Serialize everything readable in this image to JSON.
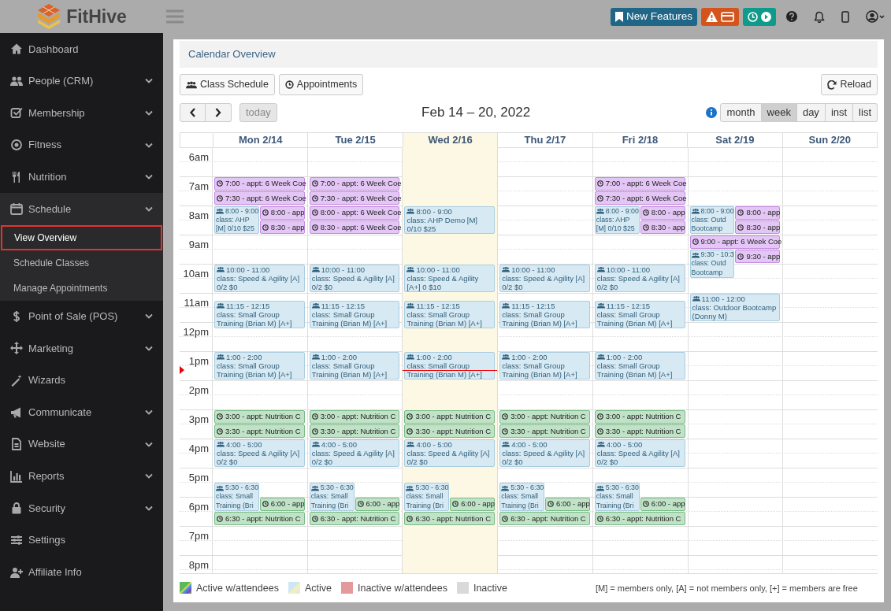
{
  "brand": "FitHive",
  "topbar": {
    "new_features": "New Features"
  },
  "sidebar": {
    "items": [
      {
        "label": "Dashboard"
      },
      {
        "label": "People (CRM)",
        "expanded": false
      },
      {
        "label": "Membership",
        "expanded": false
      },
      {
        "label": "Fitness",
        "expanded": false
      },
      {
        "label": "Nutrition",
        "expanded": false
      },
      {
        "label": "Schedule",
        "expanded": true,
        "children": [
          {
            "label": "View Overview",
            "selected": true
          },
          {
            "label": "Schedule Classes",
            "selected": false
          },
          {
            "label": "Manage Appointments",
            "selected": false
          }
        ]
      },
      {
        "label": "Point of Sale (POS)",
        "expanded": false
      },
      {
        "label": "Marketing",
        "expanded": false
      },
      {
        "label": "Wizards"
      },
      {
        "label": "Communicate",
        "expanded": false
      },
      {
        "label": "Website",
        "expanded": false
      },
      {
        "label": "Reports",
        "expanded": false
      },
      {
        "label": "Security",
        "expanded": false
      },
      {
        "label": "Settings"
      },
      {
        "label": "Affiliate Info"
      }
    ]
  },
  "page": {
    "title": "Calendar Overview",
    "buttons": [
      {
        "label": "Class Schedule",
        "kind": "classes"
      },
      {
        "label": "Appointments",
        "kind": "appointments"
      }
    ],
    "reload": "Reload"
  },
  "calendar": {
    "title": "Feb 14 – 20, 2022",
    "today_button": {
      "label": "today",
      "disabled": true
    },
    "views": [
      {
        "label": "month",
        "selected": false
      },
      {
        "label": "week",
        "selected": true
      },
      {
        "label": "day",
        "selected": false
      },
      {
        "label": "inst",
        "selected": false
      },
      {
        "label": "list",
        "selected": false
      }
    ],
    "hours": [
      "6am",
      "7am",
      "8am",
      "9am",
      "10am",
      "11am",
      "12pm",
      "1pm",
      "2pm",
      "3pm",
      "4pm",
      "5pm",
      "6pm",
      "7pm",
      "8pm"
    ],
    "now": {
      "level": 0.51
    },
    "days": [
      {
        "label": "Mon 2/14",
        "today": false,
        "events": [
          {
            "kind": "appt",
            "text": "7:00 - appt: 6 Week Coe",
            "narrow": false,
            "overlay": false,
            "color": "#e3c6f5"
          },
          {
            "kind": "appt",
            "text": "7:30 - appt: 6 Week Coe",
            "narrow": false,
            "overlay": false,
            "color": "#e3c6f5"
          },
          {
            "kind": "class",
            "time": "8:00 - 9:00",
            "lines": [
              "class: AHP",
              "[M] 0/10 $25"
            ],
            "narrow": true,
            "overlay": false,
            "color": "#d7e9f3"
          },
          {
            "kind": "appt",
            "text": "8:00 - app",
            "narrow": false,
            "overlay": true,
            "color": "#e3c6f5"
          },
          {
            "kind": "appt",
            "text": "8:30 - app",
            "narrow": false,
            "overlay": true,
            "color": "#e3c6f5"
          },
          {
            "kind": "class",
            "time": "10:00 - 11:00",
            "title": "class: Speed & Agility [A] 0/2 $0",
            "narrow": false,
            "overlay": false,
            "color": "#d7e9f3"
          },
          {
            "kind": "class",
            "time": "11:15 - 12:15",
            "title": "class: Small Group Training (Brian M) [A+]",
            "narrow": false,
            "overlay": false,
            "color": "#d7e9f3"
          },
          {
            "kind": "class",
            "time": "1:00 - 2:00",
            "title": "class: Small Group Training (Brian M) [A+]",
            "narrow": false,
            "overlay": false,
            "color": "#d7e9f3"
          },
          {
            "kind": "appt",
            "text": "3:00 - appt: Nutrition C",
            "narrow": false,
            "overlay": false,
            "color": "#c0e2c7"
          },
          {
            "kind": "appt",
            "text": "3:30 - appt: Nutrition C",
            "narrow": false,
            "overlay": false,
            "color": "#c0e2c7"
          },
          {
            "kind": "class",
            "time": "4:00 - 5:00",
            "title": "class: Speed & Agility [A] 0/2 $0",
            "narrow": false,
            "overlay": false,
            "color": "#d7e9f3"
          },
          {
            "kind": "class",
            "time": "5:30 - 6:30",
            "lines": [
              "class: Small",
              "Training (Bri"
            ],
            "narrow": true,
            "overlay": false,
            "color": "#d7e9f3"
          },
          {
            "kind": "appt",
            "text": "6:00 - app",
            "narrow": false,
            "overlay": true,
            "color": "#c0e2c7"
          },
          {
            "kind": "appt",
            "text": "6:30 - appt: Nutrition C",
            "narrow": false,
            "overlay": false,
            "color": "#c0e2c7"
          }
        ]
      },
      {
        "label": "Tue 2/15",
        "today": false,
        "events": [
          {
            "kind": "appt",
            "text": "7:00 - appt: 6 Week Coe",
            "narrow": false,
            "overlay": false,
            "color": "#e3c6f5"
          },
          {
            "kind": "appt",
            "text": "7:30 - appt: 6 Week Coe",
            "narrow": false,
            "overlay": false,
            "color": "#e3c6f5"
          },
          {
            "kind": "appt",
            "text": "8:00 - appt: 6 Week Coe",
            "narrow": false,
            "overlay": false,
            "color": "#e3c6f5"
          },
          {
            "kind": "appt",
            "text": "8:30 - appt: 6 Week Coe",
            "narrow": false,
            "overlay": false,
            "color": "#e3c6f5"
          },
          {
            "kind": "class",
            "time": "10:00 - 11:00",
            "title": "class: Speed & Agility [A] 0/2 $0",
            "narrow": false,
            "overlay": false,
            "color": "#d7e9f3"
          },
          {
            "kind": "class",
            "time": "11:15 - 12:15",
            "title": "class: Small Group Training (Brian M) [A+]",
            "narrow": false,
            "overlay": false,
            "color": "#d7e9f3"
          },
          {
            "kind": "class",
            "time": "1:00 - 2:00",
            "title": "class: Small Group Training (Brian M) [A+]",
            "narrow": false,
            "overlay": false,
            "color": "#d7e9f3"
          },
          {
            "kind": "appt",
            "text": "3:00 - appt: Nutrition C",
            "narrow": false,
            "overlay": false,
            "color": "#c0e2c7"
          },
          {
            "kind": "appt",
            "text": "3:30 - appt: Nutrition C",
            "narrow": false,
            "overlay": false,
            "color": "#c0e2c7"
          },
          {
            "kind": "class",
            "time": "4:00 - 5:00",
            "title": "class: Speed & Agility [A] 0/2 $0",
            "narrow": false,
            "overlay": false,
            "color": "#d7e9f3"
          },
          {
            "kind": "class",
            "time": "5:30 - 6:30",
            "lines": [
              "class: Small",
              "Training (Bri"
            ],
            "narrow": true,
            "overlay": false,
            "color": "#d7e9f3"
          },
          {
            "kind": "appt",
            "text": "6:00 - app",
            "narrow": false,
            "overlay": true,
            "color": "#c0e2c7"
          },
          {
            "kind": "appt",
            "text": "6:30 - appt: Nutrition C",
            "narrow": false,
            "overlay": false,
            "color": "#c0e2c7"
          }
        ]
      },
      {
        "label": "Wed 2/16",
        "today": true,
        "events": [
          {
            "kind": "class",
            "time": "8:00 - 9:00",
            "title": "class: AHP Demo [M] 0/10 $25",
            "narrow": false,
            "overlay": false,
            "color": "#d7e9f3"
          },
          {
            "kind": "class",
            "time": "10:00 - 11:00",
            "title": "class: Speed & Agility [A+] 0 $10",
            "narrow": false,
            "overlay": false,
            "color": "#d7e9f3"
          },
          {
            "kind": "class",
            "time": "11:15 - 12:15",
            "title": "class: Small Group Training (Brian M) [A+]",
            "narrow": false,
            "overlay": false,
            "color": "#d7e9f3"
          },
          {
            "kind": "class",
            "time": "1:00 - 2:00",
            "title": "class: Small Group Training (Brian M) [A+]",
            "narrow": false,
            "overlay": false,
            "color": "#d7e9f3"
          },
          {
            "kind": "appt",
            "text": "3:00 - appt: Nutrition C",
            "narrow": false,
            "overlay": false,
            "color": "#c0e2c7"
          },
          {
            "kind": "appt",
            "text": "3:30 - appt: Nutrition C",
            "narrow": false,
            "overlay": false,
            "color": "#c0e2c7"
          },
          {
            "kind": "class",
            "time": "4:00 - 5:00",
            "title": "class: Speed & Agility [A] 0/2 $0",
            "narrow": false,
            "overlay": false,
            "color": "#d7e9f3"
          },
          {
            "kind": "class",
            "time": "5:30 - 6:30",
            "lines": [
              "class: Small",
              "Training (Bri"
            ],
            "narrow": true,
            "overlay": false,
            "color": "#d7e9f3"
          },
          {
            "kind": "appt",
            "text": "6:00 - app",
            "narrow": false,
            "overlay": true,
            "color": "#c0e2c7"
          },
          {
            "kind": "appt",
            "text": "6:30 - appt: Nutrition C",
            "narrow": false,
            "overlay": false,
            "color": "#c0e2c7"
          }
        ]
      },
      {
        "label": "Thu 2/17",
        "today": false,
        "events": [
          {
            "kind": "class",
            "time": "10:00 - 11:00",
            "title": "class: Speed & Agility [A] 0/2 $0",
            "narrow": false,
            "overlay": false,
            "color": "#d7e9f3"
          },
          {
            "kind": "class",
            "time": "11:15 - 12:15",
            "title": "class: Small Group Training (Brian M) [A+]",
            "narrow": false,
            "overlay": false,
            "color": "#d7e9f3"
          },
          {
            "kind": "class",
            "time": "1:00 - 2:00",
            "title": "class: Small Group Training (Brian M) [A+]",
            "narrow": false,
            "overlay": false,
            "color": "#d7e9f3"
          },
          {
            "kind": "appt",
            "text": "3:00 - appt: Nutrition C",
            "narrow": false,
            "overlay": false,
            "color": "#c0e2c7"
          },
          {
            "kind": "appt",
            "text": "3:30 - appt: Nutrition C",
            "narrow": false,
            "overlay": false,
            "color": "#c0e2c7"
          },
          {
            "kind": "class",
            "time": "4:00 - 5:00",
            "title": "class: Speed & Agility [A] 0/2 $0",
            "narrow": false,
            "overlay": false,
            "color": "#d7e9f3"
          },
          {
            "kind": "class",
            "time": "5:30 - 6:30",
            "lines": [
              "class: Small",
              "Training (Bri"
            ],
            "narrow": true,
            "overlay": false,
            "color": "#d7e9f3"
          },
          {
            "kind": "appt",
            "text": "6:00 - app",
            "narrow": false,
            "overlay": true,
            "color": "#c0e2c7"
          },
          {
            "kind": "appt",
            "text": "6:30 - appt: Nutrition C",
            "narrow": false,
            "overlay": false,
            "color": "#c0e2c7"
          }
        ]
      },
      {
        "label": "Fri 2/18",
        "today": false,
        "events": [
          {
            "kind": "appt",
            "text": "7:00 - appt: 6 Week Coe",
            "narrow": false,
            "overlay": false,
            "color": "#e3c6f5"
          },
          {
            "kind": "appt",
            "text": "7:30 - appt: 6 Week Coe",
            "narrow": false,
            "overlay": false,
            "color": "#e3c6f5"
          },
          {
            "kind": "class",
            "time": "8:00 - 9:00",
            "lines": [
              "class: AHP",
              "[M] 0/10 $25"
            ],
            "narrow": true,
            "overlay": false,
            "color": "#d7e9f3"
          },
          {
            "kind": "appt",
            "text": "8:00 - app",
            "narrow": false,
            "overlay": true,
            "color": "#e3c6f5"
          },
          {
            "kind": "appt",
            "text": "8:30 - app",
            "narrow": false,
            "overlay": true,
            "color": "#e3c6f5"
          },
          {
            "kind": "class",
            "time": "10:00 - 11:00",
            "title": "class: Speed & Agility [A] 0/2 $0",
            "narrow": false,
            "overlay": false,
            "color": "#d7e9f3"
          },
          {
            "kind": "class",
            "time": "11:15 - 12:15",
            "title": "class: Small Group Training (Brian M) [A+]",
            "narrow": false,
            "overlay": false,
            "color": "#d7e9f3"
          },
          {
            "kind": "class",
            "time": "1:00 - 2:00",
            "title": "class: Small Group Training (Brian M) [A+]",
            "narrow": false,
            "overlay": false,
            "color": "#d7e9f3"
          },
          {
            "kind": "appt",
            "text": "3:00 - appt: Nutrition C",
            "narrow": false,
            "overlay": false,
            "color": "#c0e2c7"
          },
          {
            "kind": "appt",
            "text": "3:30 - appt: Nutrition C",
            "narrow": false,
            "overlay": false,
            "color": "#c0e2c7"
          },
          {
            "kind": "class",
            "time": "4:00 - 5:00",
            "title": "class: Speed & Agility [A] 0/2 $0",
            "narrow": false,
            "overlay": false,
            "color": "#d7e9f3"
          },
          {
            "kind": "class",
            "time": "5:30 - 6:30",
            "lines": [
              "class: Small",
              "Training (Bri"
            ],
            "narrow": true,
            "overlay": false,
            "color": "#d7e9f3"
          },
          {
            "kind": "appt",
            "text": "6:00 - app",
            "narrow": false,
            "overlay": true,
            "color": "#c0e2c7"
          },
          {
            "kind": "appt",
            "text": "6:30 - appt: Nutrition C",
            "narrow": false,
            "overlay": false,
            "color": "#c0e2c7"
          }
        ]
      },
      {
        "label": "Sat 2/19",
        "today": false,
        "events": [
          {
            "kind": "class",
            "time": "8:00 - 9:00",
            "lines": [
              "class: Outd",
              "Bootcamp"
            ],
            "narrow": true,
            "overlay": false,
            "color": "#d7e9f3"
          },
          {
            "kind": "appt",
            "text": "8:00 - app",
            "narrow": false,
            "overlay": true,
            "color": "#e3c6f5"
          },
          {
            "kind": "appt",
            "text": "8:30 - app",
            "narrow": false,
            "overlay": true,
            "color": "#e3c6f5"
          },
          {
            "kind": "appt",
            "text": "9:00 - appt: 6 Week Coe",
            "narrow": false,
            "overlay": false,
            "color": "#e3c6f5"
          },
          {
            "kind": "class",
            "time": "9:30 - 10:3",
            "lines": [
              "class: Outd",
              "Bootcamp"
            ],
            "narrow": true,
            "overlay": false,
            "color": "#d7e9f3"
          },
          {
            "kind": "appt",
            "text": "9:30 - app",
            "narrow": false,
            "overlay": true,
            "color": "#e3c6f5"
          },
          {
            "kind": "class",
            "time": "11:00 - 12:00",
            "title": "class: Outdoor Bootcamp (Donny M)",
            "narrow": false,
            "overlay": false,
            "color": "#d7e9f3"
          }
        ]
      },
      {
        "label": "Sun 2/20",
        "today": false
      }
    ]
  },
  "legend": {
    "items": [
      {
        "label": "Active w/attendees",
        "kind": "active_attendees"
      },
      {
        "label": "Active",
        "kind": "active"
      },
      {
        "label": "Inactive w/attendees",
        "kind": "inactive_attendees"
      },
      {
        "label": "Inactive",
        "kind": "inactive"
      }
    ],
    "note": "[M] = members only, [A] = not members only, [+] = members are free"
  }
}
